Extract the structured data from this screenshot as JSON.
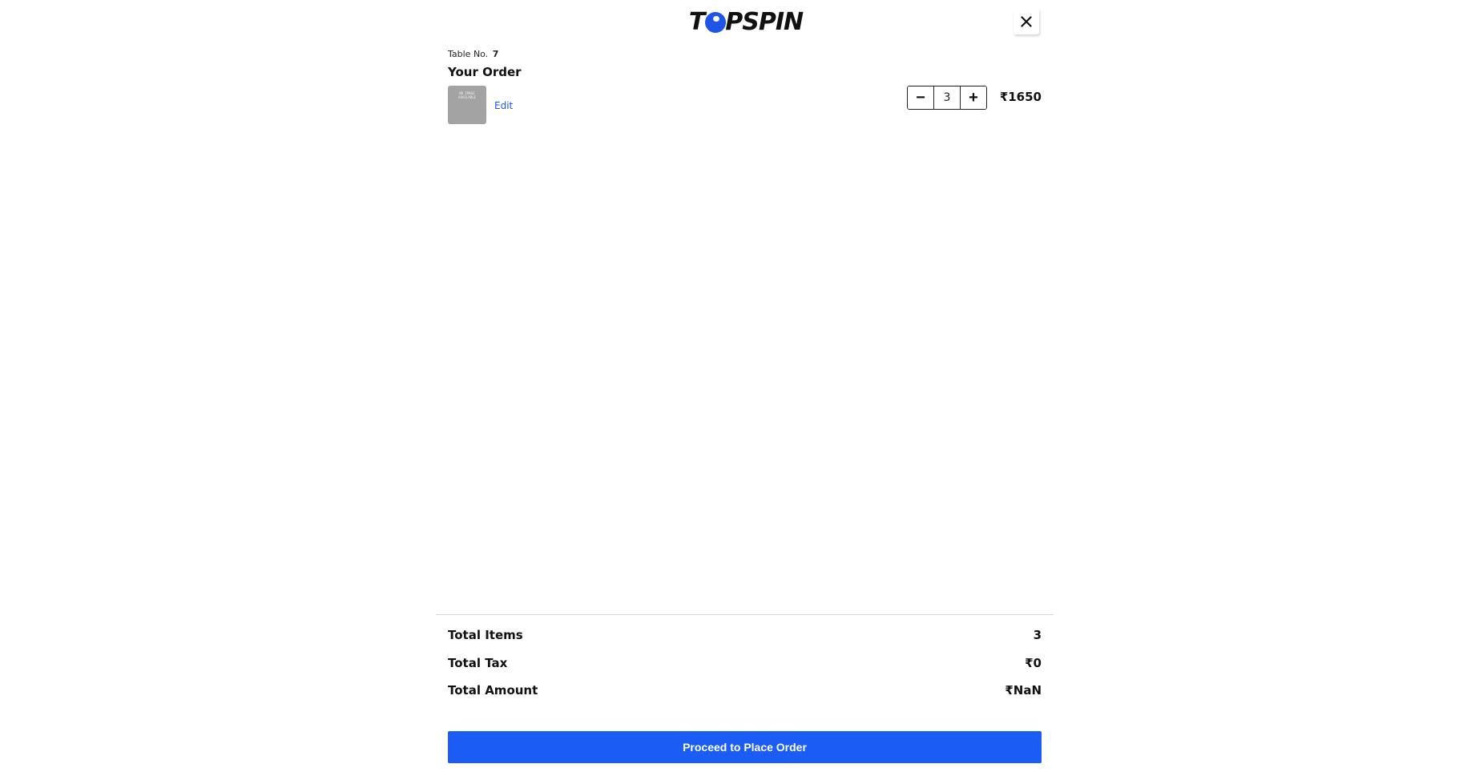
{
  "header": {
    "brand": {
      "before": "T",
      "after": "PSPIN"
    },
    "close_icon": "×"
  },
  "order": {
    "table_label": "Table No.",
    "table_number": "7",
    "heading": "Your Order"
  },
  "item": {
    "image_placeholder": "NO IMAGE AVAILABLE",
    "edit_label": "Edit",
    "decrement_label": "−",
    "quantity": "3",
    "increment_label": "+",
    "price": "₹1650"
  },
  "summary": {
    "total_items_label": "Total Items",
    "total_items_value": "3",
    "total_tax_label": "Total Tax",
    "total_tax_value": "₹0",
    "total_amount_label": "Total Amount",
    "total_amount_value": "₹NaN"
  },
  "actions": {
    "proceed_label": "Proceed to Place Order"
  },
  "colors": {
    "accent": "#1a5cf4",
    "link": "#1f55e6",
    "thumb": "#a3a3a3"
  }
}
